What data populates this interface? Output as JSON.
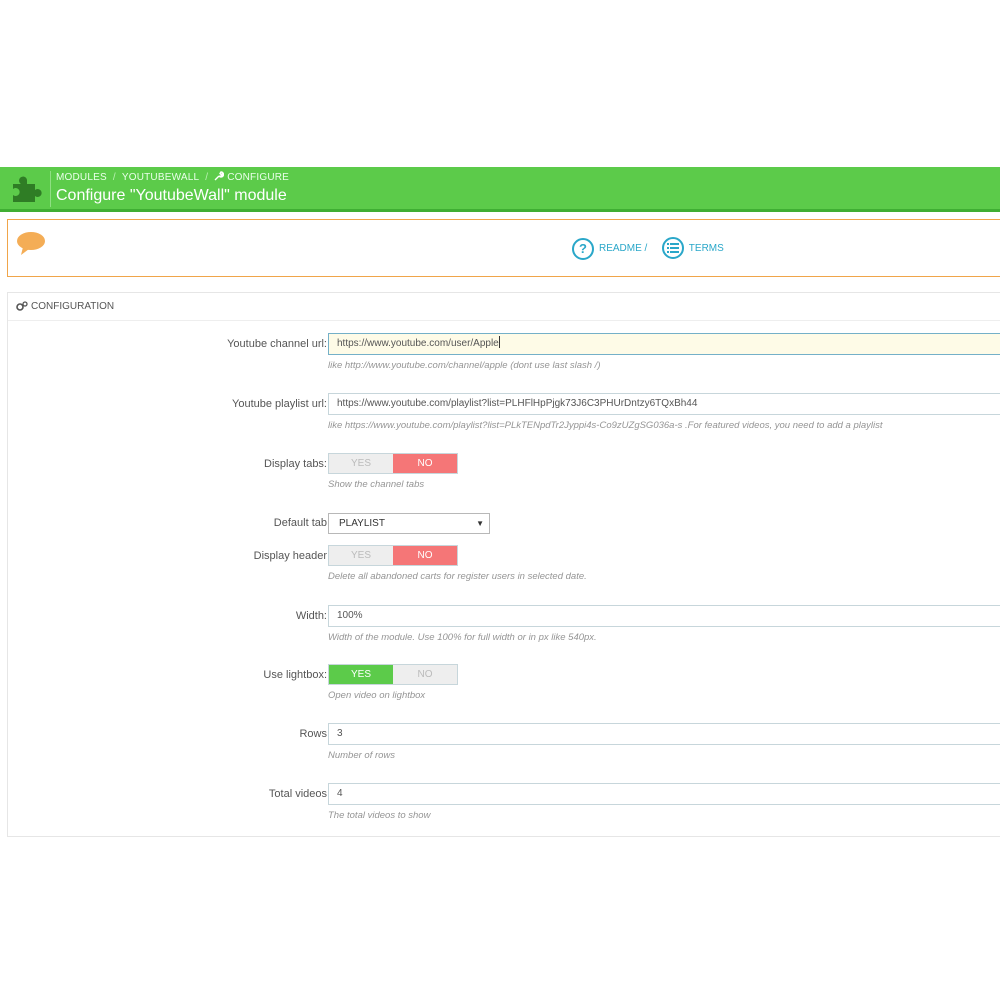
{
  "colors": {
    "header": "#5ccb4a",
    "accent_link": "#2aa7c9",
    "warning_border": "#f0a54a",
    "toggle_no": "#f57677",
    "toggle_yes": "#5ccb4a"
  },
  "header": {
    "icon": "puzzle-icon",
    "breadcrumb": [
      "MODULES",
      "YOUTUBEWALL",
      "CONFIGURE"
    ],
    "title": "Configure \"YoutubeWall\" module"
  },
  "help": {
    "icon": "speech-bubble-icon",
    "readme_label": "README /",
    "terms_label": "TERMS"
  },
  "panel": {
    "heading": "CONFIGURATION",
    "fields": {
      "channel_url": {
        "label": "Youtube channel url:",
        "value": "https://www.youtube.com/user/Apple",
        "hint": "like http://www.youtube.com/channel/apple (dont use last slash /)"
      },
      "playlist_url": {
        "label": "Youtube playlist url:",
        "value": "https://www.youtube.com/playlist?list=PLHFlHpPjgk73J6C3PHUrDntzy6TQxBh44",
        "hint": "like https://www.youtube.com/playlist?list=PLkTENpdTr2Jyppi4s-Co9zUZgSG036a-s .For featured videos, you need to add a playlist"
      },
      "display_tabs": {
        "label": "Display tabs:",
        "yes": "YES",
        "no": "NO",
        "selected": "NO",
        "hint": "Show the channel tabs"
      },
      "default_tab": {
        "label": "Default tab",
        "value": "PLAYLIST"
      },
      "display_header": {
        "label": "Display header",
        "yes": "YES",
        "no": "NO",
        "selected": "NO",
        "hint": "Delete all abandoned carts for register users in selected date."
      },
      "width": {
        "label": "Width:",
        "value": "100%",
        "hint": "Width of the module. Use 100% for full width or in px like 540px."
      },
      "use_lightbox": {
        "label": "Use lightbox:",
        "yes": "YES",
        "no": "NO",
        "selected": "YES",
        "hint": "Open video on lightbox"
      },
      "rows": {
        "label": "Rows",
        "value": "3",
        "hint": "Number of rows"
      },
      "total_videos": {
        "label": "Total videos",
        "value": "4",
        "hint": "The total videos to show"
      }
    }
  }
}
